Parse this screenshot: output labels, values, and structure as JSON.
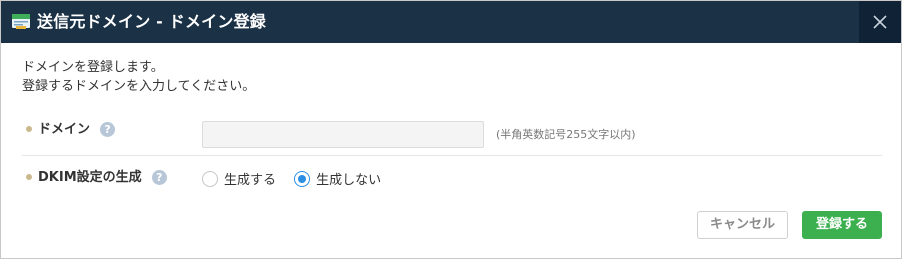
{
  "dialog": {
    "title": "送信元ドメイン - ドメイン登録",
    "icon": "domain-register-icon",
    "close_icon": "close-icon"
  },
  "description": {
    "line1": "ドメインを登録します。",
    "line2": "登録するドメインを入力してください。"
  },
  "form": {
    "domain": {
      "label": "ドメイン",
      "help": "?",
      "value": "",
      "hint": "(半角英数記号255文字以内)"
    },
    "dkim": {
      "label": "DKIM設定の生成",
      "help": "?",
      "options": [
        {
          "label": "生成する",
          "selected": false
        },
        {
          "label": "生成しない",
          "selected": true
        }
      ]
    }
  },
  "buttons": {
    "cancel": "キャンセル",
    "register": "登録する"
  },
  "colors": {
    "titlebar": "#1a3146",
    "primary_green": "#3cb04e",
    "radio_blue": "#2d8fe4"
  }
}
